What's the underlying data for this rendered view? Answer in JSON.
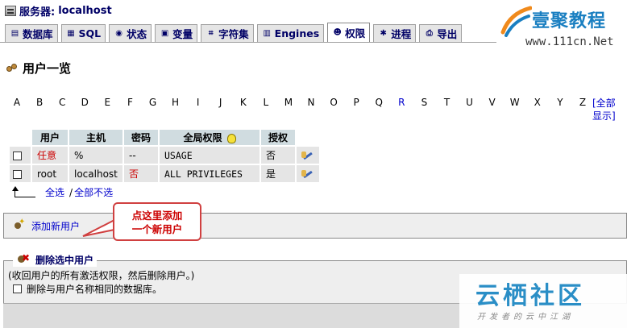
{
  "server": {
    "label": "服务器:",
    "name": "localhost"
  },
  "tabs": [
    {
      "label": "数据库",
      "icon": "database-icon",
      "active": false
    },
    {
      "label": "SQL",
      "icon": "sql-icon",
      "active": false
    },
    {
      "label": "状态",
      "icon": "status-icon",
      "active": false
    },
    {
      "label": "变量",
      "icon": "variables-icon",
      "active": false
    },
    {
      "label": "字符集",
      "icon": "charset-icon",
      "active": false
    },
    {
      "label": "Engines",
      "icon": "engines-icon",
      "active": false
    },
    {
      "label": "权限",
      "icon": "privileges-icon",
      "active": true
    },
    {
      "label": "进程",
      "icon": "processes-icon",
      "active": false
    },
    {
      "label": "导出",
      "icon": "export-icon",
      "active": false
    }
  ],
  "logo": {
    "brand": "壹聚教程",
    "url": "www.111cn.Net"
  },
  "heading": "用户一览",
  "letters": [
    "A",
    "B",
    "C",
    "D",
    "E",
    "F",
    "G",
    "H",
    "I",
    "J",
    "K",
    "L",
    "M",
    "N",
    "O",
    "P",
    "Q",
    "R",
    "S",
    "T",
    "U",
    "V",
    "W",
    "X",
    "Y",
    "Z"
  ],
  "letter_links": [
    "R"
  ],
  "show_all": "[全部显示]",
  "table": {
    "headers": {
      "user": "用户",
      "host": "主机",
      "password": "密码",
      "global": "全局权限",
      "grant": "授权"
    },
    "rows": [
      {
        "user": "任意",
        "host": "%",
        "password": "--",
        "privileges": "USAGE",
        "grant": "否"
      },
      {
        "user": "root",
        "host": "localhost",
        "password": "否",
        "privileges": "ALL PRIVILEGES",
        "grant": "是"
      }
    ]
  },
  "select": {
    "all": "全选",
    "separator": "/",
    "none": "全部不选"
  },
  "add_user": {
    "link": "添加新用户"
  },
  "callout": {
    "line1": "点这里添加",
    "line2": "一个新用户"
  },
  "delete": {
    "legend": "删除选中用户",
    "desc": "(收回用户的所有激活权限，然后删除用户。)",
    "option": "删除与用户名称相同的数据库。"
  },
  "watermark": {
    "title": "云栖社区",
    "sub": "开发者的云中江湖"
  },
  "colors": {
    "link": "#0000cc",
    "header_bg": "#d0dce0",
    "cell_bg": "#e5e5e5",
    "callout": "#cc0000"
  }
}
